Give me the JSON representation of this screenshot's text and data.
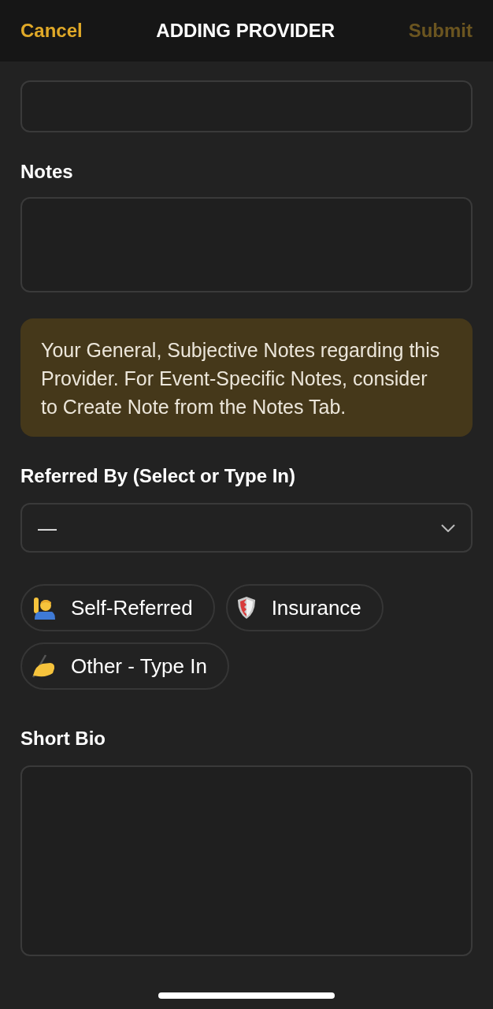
{
  "header": {
    "cancel": "Cancel",
    "title": "ADDING PROVIDER",
    "submit": {
      "label": "Submit",
      "disabled": true
    }
  },
  "notes": {
    "label": "Notes"
  },
  "hint": "Your General, Subjective Notes regarding this Provider. For Event-Specific Notes, consider to Create Note from the Notes Tab.",
  "referred_by": {
    "label": "Referred By (Select or Type In)",
    "value": "—",
    "chips": [
      {
        "label": "Self-Referred",
        "kind": "person"
      },
      {
        "label": "Insurance",
        "kind": "shield"
      },
      {
        "label": "Other - Type In",
        "kind": "hand"
      }
    ]
  },
  "bio": {
    "label": "Short Bio"
  }
}
